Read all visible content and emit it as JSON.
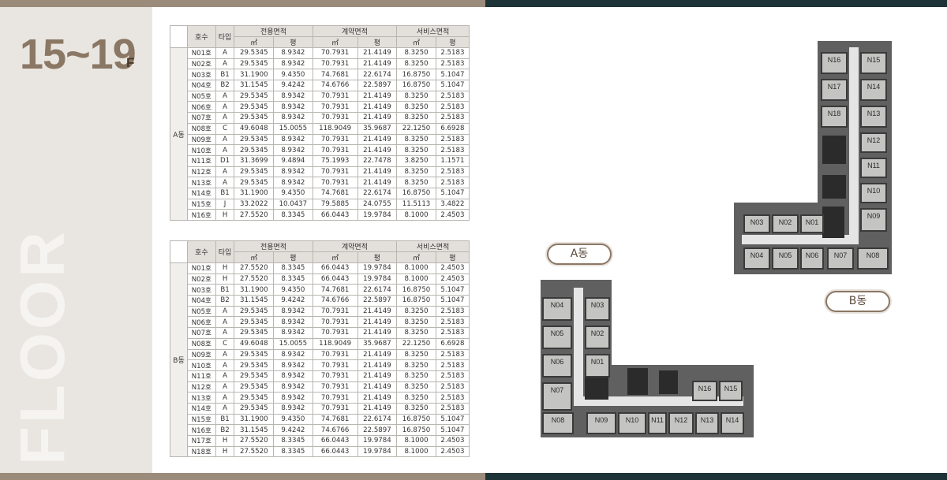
{
  "page": {
    "title": "15~19",
    "title_unit": "F",
    "side_word": "FLOOR"
  },
  "columns": {
    "ho": "호수",
    "type": "타입",
    "exclusive": "전용면적",
    "contract": "계약면적",
    "service": "서비스면적",
    "sqm": "㎡",
    "pyeong": "평"
  },
  "tableA": {
    "dong": "A동",
    "rows": [
      [
        "N01호",
        "A",
        "29.5345",
        "8.9342",
        "70.7931",
        "21.4149",
        "8.3250",
        "2.5183"
      ],
      [
        "N02호",
        "A",
        "29.5345",
        "8.9342",
        "70.7931",
        "21.4149",
        "8.3250",
        "2.5183"
      ],
      [
        "N03호",
        "B1",
        "31.1900",
        "9.4350",
        "74.7681",
        "22.6174",
        "16.8750",
        "5.1047"
      ],
      [
        "N04호",
        "B2",
        "31.1545",
        "9.4242",
        "74.6766",
        "22.5897",
        "16.8750",
        "5.1047"
      ],
      [
        "N05호",
        "A",
        "29.5345",
        "8.9342",
        "70.7931",
        "21.4149",
        "8.3250",
        "2.5183"
      ],
      [
        "N06호",
        "A",
        "29.5345",
        "8.9342",
        "70.7931",
        "21.4149",
        "8.3250",
        "2.5183"
      ],
      [
        "N07호",
        "A",
        "29.5345",
        "8.9342",
        "70.7931",
        "21.4149",
        "8.3250",
        "2.5183"
      ],
      [
        "N08호",
        "C",
        "49.6048",
        "15.0055",
        "118.9049",
        "35.9687",
        "22.1250",
        "6.6928"
      ],
      [
        "N09호",
        "A",
        "29.5345",
        "8.9342",
        "70.7931",
        "21.4149",
        "8.3250",
        "2.5183"
      ],
      [
        "N10호",
        "A",
        "29.5345",
        "8.9342",
        "70.7931",
        "21.4149",
        "8.3250",
        "2.5183"
      ],
      [
        "N11호",
        "D1",
        "31.3699",
        "9.4894",
        "75.1993",
        "22.7478",
        "3.8250",
        "1.1571"
      ],
      [
        "N12호",
        "A",
        "29.5345",
        "8.9342",
        "70.7931",
        "21.4149",
        "8.3250",
        "2.5183"
      ],
      [
        "N13호",
        "A",
        "29.5345",
        "8.9342",
        "70.7931",
        "21.4149",
        "8.3250",
        "2.5183"
      ],
      [
        "N14호",
        "B1",
        "31.1900",
        "9.4350",
        "74.7681",
        "22.6174",
        "16.8750",
        "5.1047"
      ],
      [
        "N15호",
        "J",
        "33.2022",
        "10.0437",
        "79.5885",
        "24.0755",
        "11.5113",
        "3.4822"
      ],
      [
        "N16호",
        "H",
        "27.5520",
        "8.3345",
        "66.0443",
        "19.9784",
        "8.1000",
        "2.4503"
      ]
    ]
  },
  "tableB": {
    "dong": "B동",
    "rows": [
      [
        "N01호",
        "H",
        "27.5520",
        "8.3345",
        "66.0443",
        "19.9784",
        "8.1000",
        "2.4503"
      ],
      [
        "N02호",
        "H",
        "27.5520",
        "8.3345",
        "66.0443",
        "19.9784",
        "8.1000",
        "2.4503"
      ],
      [
        "N03호",
        "B1",
        "31.1900",
        "9.4350",
        "74.7681",
        "22.6174",
        "16.8750",
        "5.1047"
      ],
      [
        "N04호",
        "B2",
        "31.1545",
        "9.4242",
        "74.6766",
        "22.5897",
        "16.8750",
        "5.1047"
      ],
      [
        "N05호",
        "A",
        "29.5345",
        "8.9342",
        "70.7931",
        "21.4149",
        "8.3250",
        "2.5183"
      ],
      [
        "N06호",
        "A",
        "29.5345",
        "8.9342",
        "70.7931",
        "21.4149",
        "8.3250",
        "2.5183"
      ],
      [
        "N07호",
        "A",
        "29.5345",
        "8.9342",
        "70.7931",
        "21.4149",
        "8.3250",
        "2.5183"
      ],
      [
        "N08호",
        "C",
        "49.6048",
        "15.0055",
        "118.9049",
        "35.9687",
        "22.1250",
        "6.6928"
      ],
      [
        "N09호",
        "A",
        "29.5345",
        "8.9342",
        "70.7931",
        "21.4149",
        "8.3250",
        "2.5183"
      ],
      [
        "N10호",
        "A",
        "29.5345",
        "8.9342",
        "70.7931",
        "21.4149",
        "8.3250",
        "2.5183"
      ],
      [
        "N11호",
        "A",
        "29.5345",
        "8.9342",
        "70.7931",
        "21.4149",
        "8.3250",
        "2.5183"
      ],
      [
        "N12호",
        "A",
        "29.5345",
        "8.9342",
        "70.7931",
        "21.4149",
        "8.3250",
        "2.5183"
      ],
      [
        "N13호",
        "A",
        "29.5345",
        "8.9342",
        "70.7931",
        "21.4149",
        "8.3250",
        "2.5183"
      ],
      [
        "N14호",
        "A",
        "29.5345",
        "8.9342",
        "70.7931",
        "21.4149",
        "8.3250",
        "2.5183"
      ],
      [
        "N15호",
        "B1",
        "31.1900",
        "9.4350",
        "74.7681",
        "22.6174",
        "16.8750",
        "5.1047"
      ],
      [
        "N16호",
        "B2",
        "31.1545",
        "9.4242",
        "74.6766",
        "22.5897",
        "16.8750",
        "5.1047"
      ],
      [
        "N17호",
        "H",
        "27.5520",
        "8.3345",
        "66.0443",
        "19.9784",
        "8.1000",
        "2.4503"
      ],
      [
        "N18호",
        "H",
        "27.5520",
        "8.3345",
        "66.0443",
        "19.9784",
        "8.1000",
        "2.4503"
      ]
    ]
  },
  "planA": {
    "label": "A동",
    "units": [
      "N04",
      "N03",
      "N05",
      "N02",
      "N06",
      "N01",
      "N07",
      "N16",
      "N15",
      "N08",
      "N09",
      "N10",
      "N11",
      "N12",
      "N13",
      "N14"
    ]
  },
  "planB": {
    "label": "B동",
    "units": [
      "N16",
      "N15",
      "N17",
      "N14",
      "N18",
      "N13",
      "N12",
      "N11",
      "N10",
      "N09",
      "N03",
      "N02",
      "N01",
      "N04",
      "N05",
      "N06",
      "N07",
      "N08"
    ]
  }
}
